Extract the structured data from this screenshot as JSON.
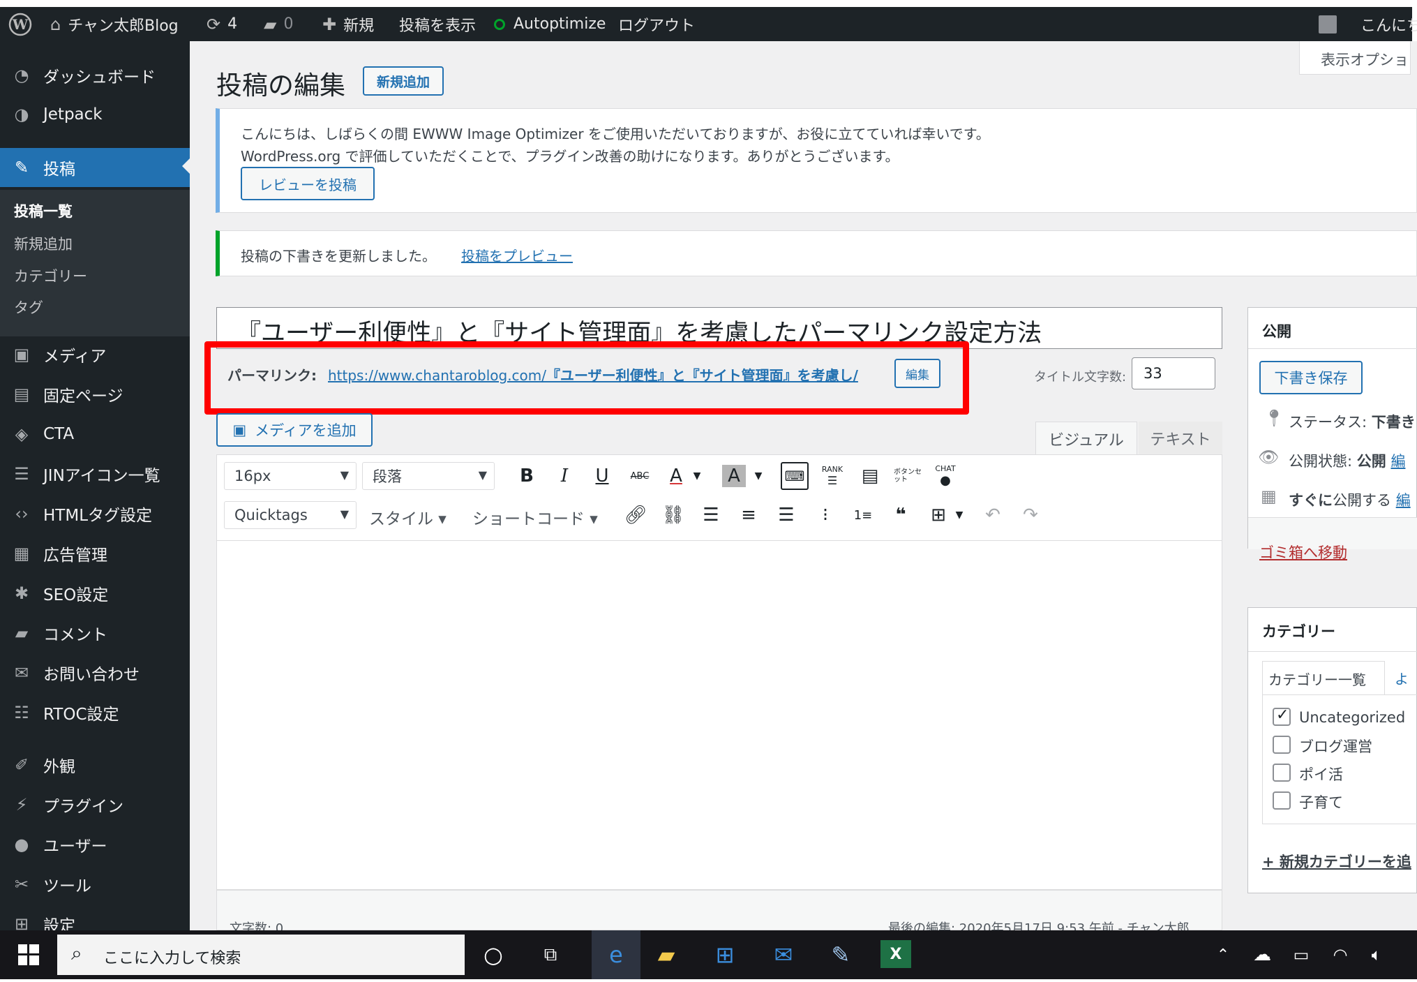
{
  "admin_bar": {
    "site_name": "チャン太郎Blog",
    "updates_count": "4",
    "comments_count": "0",
    "new_label": "新規",
    "view_post_label": "投稿を表示",
    "autoptimize_label": "Autoptimize",
    "logout_label": "ログアウト",
    "greeting": "こんにち"
  },
  "sidebar": {
    "items": [
      {
        "label": "ダッシュボード",
        "icon": "dashboard-icon"
      },
      {
        "label": "Jetpack",
        "icon": "jetpack-icon"
      },
      {
        "label": "投稿",
        "icon": "posts-icon"
      },
      {
        "label": "メディア",
        "icon": "media-icon"
      },
      {
        "label": "固定ページ",
        "icon": "page-icon"
      },
      {
        "label": "CTA",
        "icon": "cta-icon"
      },
      {
        "label": "JINアイコン一覧",
        "icon": "list-icon"
      },
      {
        "label": "HTMLタグ設定",
        "icon": "code-icon"
      },
      {
        "label": "広告管理",
        "icon": "ads-icon"
      },
      {
        "label": "SEO設定",
        "icon": "gear-icon"
      },
      {
        "label": "コメント",
        "icon": "comment-icon"
      },
      {
        "label": "お問い合わせ",
        "icon": "mail-icon"
      },
      {
        "label": "RTOC設定",
        "icon": "list-icon"
      },
      {
        "label": "外観",
        "icon": "appearance-icon"
      },
      {
        "label": "プラグイン",
        "icon": "plugin-icon"
      },
      {
        "label": "ユーザー",
        "icon": "user-icon"
      },
      {
        "label": "ツール",
        "icon": "wrench-icon"
      },
      {
        "label": "設定",
        "icon": "settings-icon"
      }
    ],
    "submenu": [
      "投稿一覧",
      "新規追加",
      "カテゴリー",
      "タグ"
    ]
  },
  "screen_options_label": "表示オプショ",
  "page": {
    "title": "投稿の編集",
    "add_new_label": "新規追加"
  },
  "notice_review": {
    "line1": "こんにちは、しばらくの間 EWWW Image Optimizer をご使用いただいておりますが、お役に立てていれば幸いです。",
    "line2": "WordPress.org で評価していただくことで、プラグイン改善の助けになります。ありがとうございます。",
    "button_label": "レビューを投稿"
  },
  "notice_updated": {
    "text": "投稿の下書きを更新しました。",
    "link": "投稿をプレビュー"
  },
  "post": {
    "title": "『ユーザー利便性』と『サイト管理面』を考慮したパーマリンク設定方法",
    "permalink_label": "パーマリンク:",
    "permalink_base": "https://www.chantaroblog.com/",
    "permalink_slug": "『ユーザー利便性』と『サイト管理面』を考慮し/",
    "edit_label": "編集",
    "title_count_label": "タイトル文字数:",
    "title_count": "33"
  },
  "editor": {
    "add_media_label": "メディアを追加",
    "tab_visual": "ビジュアル",
    "tab_text": "テキスト",
    "font_size": "16px",
    "paragraph": "段落",
    "quicktags": "Quicktags",
    "style_label": "スタイル ▾",
    "shortcode_label": "ショートコード ▾",
    "rank_label": "RANK",
    "button_set_label": "ボタンセット",
    "chat_label": "CHAT",
    "word_count": "文字数: 0",
    "last_edit": "最後の編集: 2020年5月17日 9:53 午前 - チャン太郎"
  },
  "publish_box": {
    "title": "公開",
    "save_draft_label": "下書き保存",
    "status_label": "ステータス:",
    "status_value": "下書き",
    "visibility_label": "公開状態:",
    "visibility_value": "公開",
    "visibility_edit": "編",
    "schedule_label": "すぐに",
    "schedule_rest": "公開する",
    "schedule_edit": "編",
    "trash_label": "ゴミ箱へ移動"
  },
  "category_box": {
    "title": "カテゴリー",
    "tab_all": "カテゴリー一覧",
    "tab_popular": "よ",
    "categories": [
      {
        "label": "Uncategorized",
        "checked": true
      },
      {
        "label": "ブログ運営",
        "checked": false
      },
      {
        "label": "ポイ活",
        "checked": false
      },
      {
        "label": "子育て",
        "checked": false
      }
    ],
    "add_new_label": "+ 新規カテゴリーを追"
  },
  "taskbar": {
    "search_placeholder": "ここに入力して検索"
  },
  "colors": {
    "wp_blue": "#2271b1",
    "admin_dark": "#1d2327",
    "highlight_red": "#ff0000",
    "notice_green": "#00a32a"
  }
}
